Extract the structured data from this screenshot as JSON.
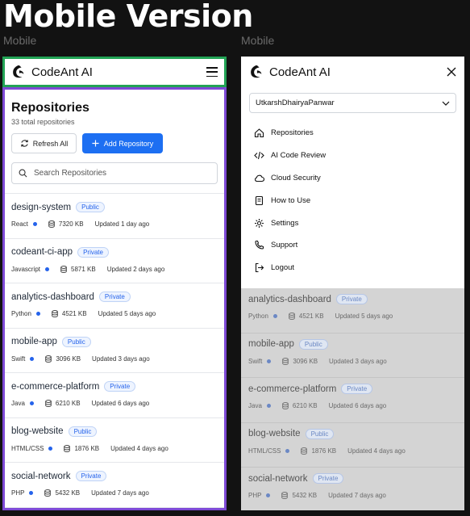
{
  "page_title": "Mobile Version",
  "frame_labels": {
    "left": "Mobile",
    "right": "Mobile"
  },
  "brand": {
    "name": "CodeAnt AI"
  },
  "colors": {
    "accent": "#1d6ff2",
    "header_outline": "#22a355",
    "body_outline": "#7e4ad6"
  },
  "left": {
    "title": "Repositories",
    "count": "33 total repositories",
    "refresh_label": "Refresh All",
    "add_label": "Add Repository",
    "search_placeholder": "Search Repositories",
    "repos": [
      {
        "name": "design-system",
        "visibility": "Public",
        "language": "React",
        "size": "7320 KB",
        "updated": "Updated 1 day ago"
      },
      {
        "name": "codeant-ci-app",
        "visibility": "Private",
        "language": "Javascript",
        "size": "5871 KB",
        "updated": "Updated 2 days ago"
      },
      {
        "name": "analytics-dashboard",
        "visibility": "Private",
        "language": "Python",
        "size": "4521 KB",
        "updated": "Updated 5 days ago"
      },
      {
        "name": "mobile-app",
        "visibility": "Public",
        "language": "Swift",
        "size": "3096 KB",
        "updated": "Updated 3 days ago"
      },
      {
        "name": "e-commerce-platform",
        "visibility": "Private",
        "language": "Java",
        "size": "6210 KB",
        "updated": "Updated 6 days ago"
      },
      {
        "name": "blog-website",
        "visibility": "Public",
        "language": "HTML/CSS",
        "size": "1876 KB",
        "updated": "Updated 4 days ago"
      },
      {
        "name": "social-network",
        "visibility": "Private",
        "language": "PHP",
        "size": "5432 KB",
        "updated": "Updated 7 days ago"
      }
    ]
  },
  "right": {
    "user": "UtkarshDhairyaPanwar",
    "menu": [
      {
        "label": "Repositories",
        "icon": "home-icon"
      },
      {
        "label": "AI Code Review",
        "icon": "code-icon"
      },
      {
        "label": "Cloud Security",
        "icon": "cloud-icon"
      },
      {
        "label": "How to Use",
        "icon": "book-icon"
      },
      {
        "label": "Settings",
        "icon": "gear-icon"
      },
      {
        "label": "Support",
        "icon": "phone-icon"
      },
      {
        "label": "Logout",
        "icon": "logout-icon"
      }
    ],
    "repos": [
      {
        "name": "analytics-dashboard",
        "visibility": "Private",
        "language": "Python",
        "size": "4521 KB",
        "updated": "Updated 5 days ago"
      },
      {
        "name": "mobile-app",
        "visibility": "Public",
        "language": "Swift",
        "size": "3096 KB",
        "updated": "Updated 3 days ago"
      },
      {
        "name": "e-commerce-platform",
        "visibility": "Private",
        "language": "Java",
        "size": "6210 KB",
        "updated": "Updated 6 days ago"
      },
      {
        "name": "blog-website",
        "visibility": "Public",
        "language": "HTML/CSS",
        "size": "1876 KB",
        "updated": "Updated 4 days ago"
      },
      {
        "name": "social-network",
        "visibility": "Private",
        "language": "PHP",
        "size": "5432 KB",
        "updated": "Updated 7 days ago"
      }
    ]
  }
}
